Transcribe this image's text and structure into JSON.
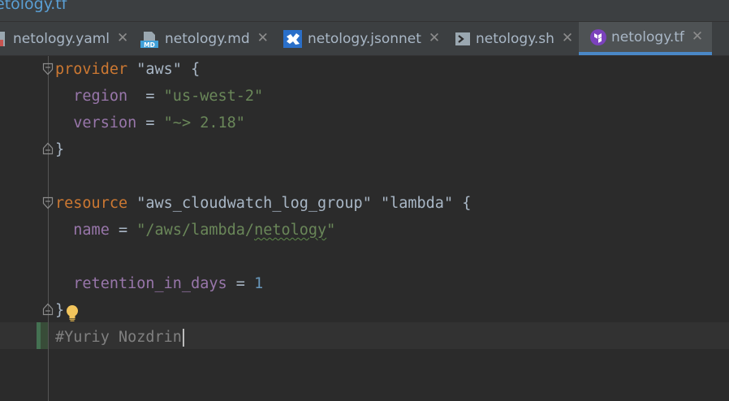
{
  "window": {
    "title": "etology.tf"
  },
  "tabs": [
    {
      "label": "netology.yaml",
      "icon": "yaml-file-icon",
      "active": false
    },
    {
      "label": "netology.md",
      "icon": "markdown-file-icon",
      "active": false
    },
    {
      "label": "netology.jsonnet",
      "icon": "jsonnet-file-icon",
      "active": false
    },
    {
      "label": "netology.sh",
      "icon": "shell-file-icon",
      "active": false
    },
    {
      "label": "netology.tf",
      "icon": "terraform-file-icon",
      "active": true
    }
  ],
  "tab_close_glyph": "✕",
  "code": {
    "line1": {
      "keyword": "provider",
      "name": "\"aws\"",
      "brace": "{"
    },
    "line2": {
      "key": "region",
      "op": "=",
      "value": "\"us-west-2\""
    },
    "line3": {
      "key": "version",
      "op": "=",
      "value": "\"~> 2.18\""
    },
    "line4": {
      "brace": "}"
    },
    "line6": {
      "keyword": "resource",
      "type": "\"aws_cloudwatch_log_group\"",
      "name": "\"lambda\"",
      "brace": "{"
    },
    "line7": {
      "key": "name",
      "op": "=",
      "value_prefix": "\"/aws/lambda/",
      "value_squiggle": "netology",
      "value_suffix": "\""
    },
    "line9": {
      "key": "retention_in_days",
      "op": "=",
      "value": "1"
    },
    "line10": {
      "brace": "}"
    },
    "line11": {
      "comment": "#Yuriy Nozdrin"
    }
  },
  "colors": {
    "keyword": "#cc7832",
    "string": "#6a8759",
    "property": "#9876aa",
    "number": "#6897bb",
    "comment": "#808080",
    "active_tab_underline": "#4a88c7"
  }
}
